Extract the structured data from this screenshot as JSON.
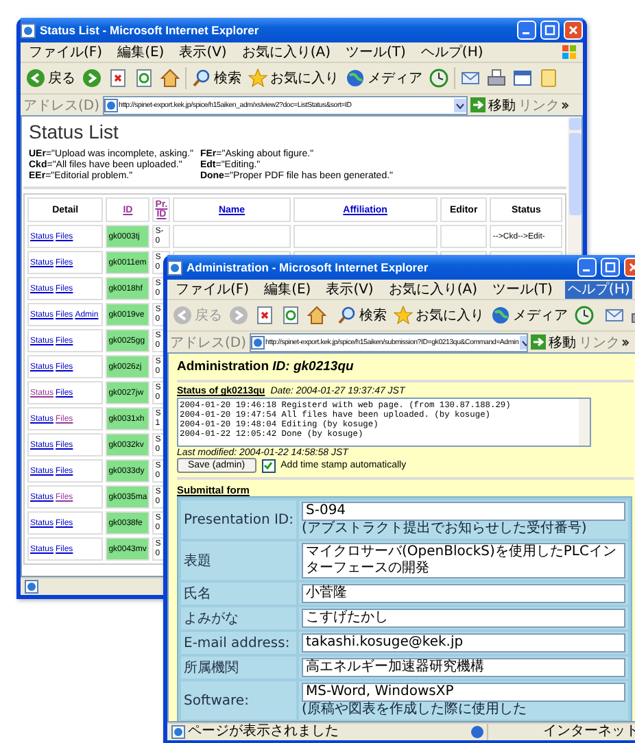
{
  "status_list_window": {
    "title": "Status List - Microsoft Internet Explorer",
    "menu": [
      {
        "label": "ファイル(F)",
        "selected": false
      },
      {
        "label": "編集(E)",
        "selected": false
      },
      {
        "label": "表示(V)",
        "selected": false
      },
      {
        "label": "お気に入り(A)",
        "selected": false
      },
      {
        "label": "ツール(T)",
        "selected": false
      },
      {
        "label": "ヘルプ(H)",
        "selected": false
      }
    ],
    "toolbar": {
      "back": {
        "label": "戻る",
        "disabled": false
      },
      "forward": {
        "disabled": false
      },
      "search": "検索",
      "favorites": "お気に入り",
      "media": "メディア"
    },
    "address": {
      "label": "アドレス(D)",
      "url": "http://spinet-export.kek.jp/spice/h15aiken_adm/xslview2?doc=ListStatus&sort=ID",
      "go": "移動",
      "links": "リンク"
    },
    "heading": "Status List",
    "legend": [
      "**UEr**=\"Upload was incomplete, asking.\"",
      "**FEr**=\"Asking about figure.\"",
      "**Ckd**=\"All files have been uploaded.\"",
      "**Edt**=\"Editing.\"",
      "**EEr**=\"Editorial problem.\"",
      "**Done**=\"Proper PDF file has been generated.\""
    ],
    "table": {
      "columns": [
        {
          "label": "Detail",
          "kind": "text"
        },
        {
          "label": "ID",
          "kind": "visited_link"
        },
        {
          "label": "Pr. ID",
          "kind": "visited_link"
        },
        {
          "label": "Name",
          "kind": "link"
        },
        {
          "label": "Affiliation",
          "kind": "link"
        },
        {
          "label": "Editor",
          "kind": "text"
        },
        {
          "label": "Status",
          "kind": "text"
        }
      ],
      "rows": [
        {
          "links": [
            {
              "label": "Status",
              "visited": false
            },
            {
              "label": "Files",
              "visited": false
            }
          ],
          "id": "gk0003tj",
          "pr_id": "S-0",
          "status": "-->Ckd-->Edit-"
        },
        {
          "links": [
            {
              "label": "Status",
              "visited": false
            },
            {
              "label": "Files",
              "visited": false
            }
          ],
          "id": "gk0011em",
          "pr_id": "S0"
        },
        {
          "links": [
            {
              "label": "Status",
              "visited": false
            },
            {
              "label": "Files",
              "visited": false
            }
          ],
          "id": "gk0018hf",
          "pr_id": "S0"
        },
        {
          "links": [
            {
              "label": "Status",
              "visited": false
            },
            {
              "label": "Files",
              "visited": false
            },
            {
              "label": "Admin",
              "visited": false
            }
          ],
          "id": "gk0019ve",
          "pr_id": "S0"
        },
        {
          "links": [
            {
              "label": "Status",
              "visited": false
            },
            {
              "label": "Files",
              "visited": false
            }
          ],
          "id": "gk0025gg",
          "pr_id": "S0"
        },
        {
          "links": [
            {
              "label": "Status",
              "visited": false
            },
            {
              "label": "Files",
              "visited": false
            }
          ],
          "id": "gk0026zj",
          "pr_id": "S0"
        },
        {
          "links": [
            {
              "label": "Status",
              "visited": true
            },
            {
              "label": "Files",
              "visited": false
            }
          ],
          "id": "gk0027jw",
          "pr_id": "S0"
        },
        {
          "links": [
            {
              "label": "Status",
              "visited": false
            },
            {
              "label": "Files",
              "visited": true
            }
          ],
          "id": "gk0031xh",
          "pr_id": "S1"
        },
        {
          "links": [
            {
              "label": "Status",
              "visited": false
            },
            {
              "label": "Files",
              "visited": false
            }
          ],
          "id": "gk0032kv",
          "pr_id": "S0"
        },
        {
          "links": [
            {
              "label": "Status",
              "visited": false
            },
            {
              "label": "Files",
              "visited": false
            }
          ],
          "id": "gk0033dy",
          "pr_id": "S0"
        },
        {
          "links": [
            {
              "label": "Status",
              "visited": false
            },
            {
              "label": "Files",
              "visited": true
            }
          ],
          "id": "gk0035ma",
          "pr_id": "S0"
        },
        {
          "links": [
            {
              "label": "Status",
              "visited": false
            },
            {
              "label": "Files",
              "visited": false
            }
          ],
          "id": "gk0038fe",
          "pr_id": "S0"
        },
        {
          "links": [
            {
              "label": "Status",
              "visited": false
            },
            {
              "label": "Files",
              "visited": false
            }
          ],
          "id": "gk0043mv",
          "pr_id": "S0"
        }
      ]
    }
  },
  "admin_window": {
    "title": "Administration - Microsoft Internet Explorer",
    "menu": [
      {
        "label": "ファイル(F)",
        "selected": false
      },
      {
        "label": "編集(E)",
        "selected": false
      },
      {
        "label": "表示(V)",
        "selected": false
      },
      {
        "label": "お気に入り(A)",
        "selected": false
      },
      {
        "label": "ツール(T)",
        "selected": false
      },
      {
        "label": "ヘルプ(H)",
        "selected": true
      }
    ],
    "toolbar": {
      "back": {
        "label": "戻る",
        "disabled": true
      },
      "forward": {
        "disabled": true
      },
      "search": "検索",
      "favorites": "お気に入り",
      "media": "メディア"
    },
    "address": {
      "label": "アドレス(D)",
      "url": "http://spinet-export.kek.jp/spice/h15aiken/submission?ID=gk0213qu&Command=Admin",
      "go": "移動",
      "links": "リンク"
    },
    "heading": "Administration *ID: gk0213qu*",
    "status_title": "Status of gk0213qu",
    "status_date": "Date: 2004-01-27 19:37:47 JST",
    "log": [
      "2004-01-20 19:46:18 Registerd with web page. (from 130.87.188.29)",
      "2004-01-20 19:47:54 All files have been uploaded. (by kosuge)",
      "2004-01-20 19:48:04 Editing (by kosuge)",
      "2004-01-22 12:05:42 Done (by kosuge)"
    ],
    "last_modified": "Last modified: 2004-01-22 14:58:58 JST",
    "save_button": "Save (admin)",
    "timestamp_checkbox": {
      "label": "Add time stamp automatically",
      "checked": true
    },
    "form": {
      "title": "Submittal form",
      "rows": [
        {
          "label": "Presentation ID:",
          "value": "S-094",
          "note": "(アブストラクト提出でお知らせした受付番号)"
        },
        {
          "label": "表題",
          "value": "マイクロサーバ(OpenBlockS)を使用したPLCインターフェースの開発"
        },
        {
          "label": "氏名",
          "value": "小菅隆"
        },
        {
          "label": "よみがな",
          "value": "こすげたかし"
        },
        {
          "label": "E-mail address:",
          "value": "takashi.kosuge@kek.jp"
        },
        {
          "label": "所属機関",
          "value": "高エネルギー加速器研究機構"
        },
        {
          "label": "Software:",
          "value": "MS-Word, WindowsXP",
          "note": "(原稿や図表を作成した際に使用した"
        }
      ]
    },
    "status_bar": {
      "text": "ページが表示されました",
      "zone": "インターネット"
    }
  }
}
